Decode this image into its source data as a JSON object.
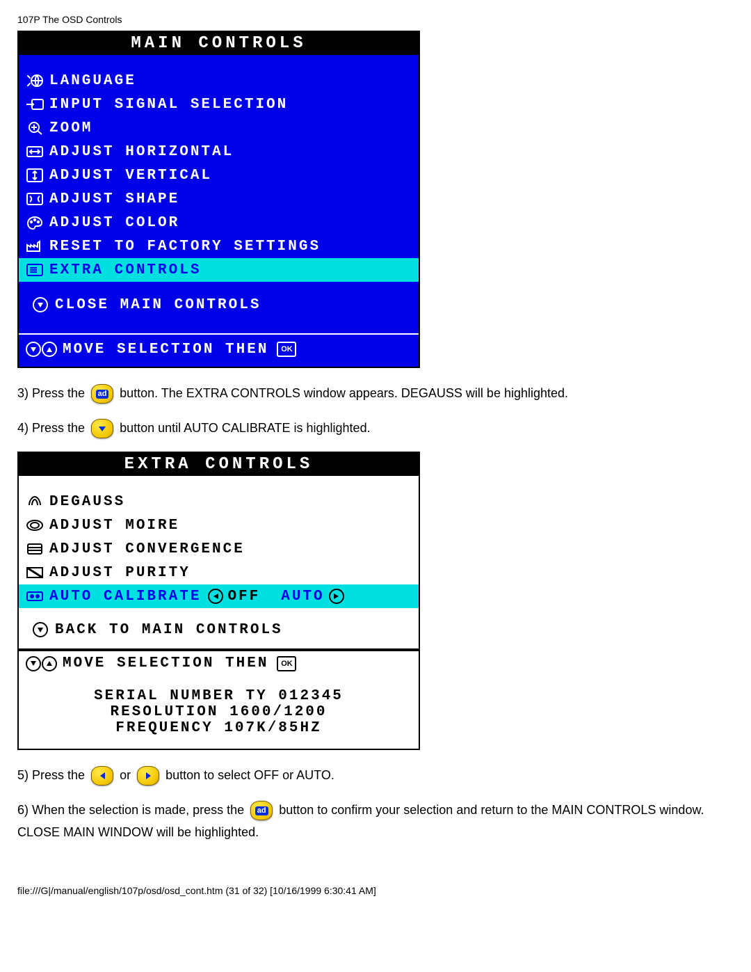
{
  "page": {
    "header": "107P The OSD Controls",
    "footer": "file:///G|/manual/english/107p/osd/osd_cont.htm (31 of 32) [10/16/1999 6:30:41 AM]"
  },
  "main_controls": {
    "title": "MAIN CONTROLS",
    "items": [
      {
        "label": "LANGUAGE",
        "icon": "globe"
      },
      {
        "label": "INPUT SIGNAL SELECTION",
        "icon": "input"
      },
      {
        "label": "ZOOM",
        "icon": "zoom"
      },
      {
        "label": "ADJUST HORIZONTAL",
        "icon": "horiz"
      },
      {
        "label": "ADJUST VERTICAL",
        "icon": "vert"
      },
      {
        "label": "ADJUST SHAPE",
        "icon": "shape"
      },
      {
        "label": "ADJUST COLOR",
        "icon": "color"
      },
      {
        "label": "RESET TO FACTORY SETTINGS",
        "icon": "factory"
      },
      {
        "label": "EXTRA CONTROLS",
        "icon": "extra",
        "highlighted": true
      }
    ],
    "close": "CLOSE MAIN CONTROLS",
    "footer": "MOVE SELECTION THEN",
    "ok": "OK"
  },
  "step3": {
    "before": "3) Press the ",
    "after": " button. The EXTRA CONTROLS window appears. DEGAUSS will be highlighted."
  },
  "step4": {
    "before": "4) Press the ",
    "after": " button until AUTO CALIBRATE is highlighted."
  },
  "extra_controls": {
    "title": "EXTRA CONTROLS",
    "items": [
      {
        "label": "DEGAUSS",
        "icon": "degauss"
      },
      {
        "label": "ADJUST MOIRE",
        "icon": "moire"
      },
      {
        "label": "ADJUST CONVERGENCE",
        "icon": "conv"
      },
      {
        "label": "ADJUST PURITY",
        "icon": "purity"
      },
      {
        "label": "AUTO CALIBRATE",
        "icon": "autocal",
        "highlighted": true,
        "opt_left": "OFF",
        "opt_right": "AUTO"
      }
    ],
    "back": "BACK TO MAIN CONTROLS",
    "footer": "MOVE SELECTION THEN",
    "ok": "OK",
    "info": {
      "serial": "SERIAL NUMBER TY 012345",
      "resolution": "RESOLUTION 1600/1200",
      "frequency": "FREQUENCY 107K/85HZ"
    }
  },
  "step5": {
    "before": "5) Press the ",
    "mid": " or ",
    "after": " button to select OFF or AUTO."
  },
  "step6": {
    "before": "6) When the selection is made, press the ",
    "after": " button to confirm your selection and return to the MAIN CONTROLS window. CLOSE MAIN WINDOW will be highlighted."
  }
}
